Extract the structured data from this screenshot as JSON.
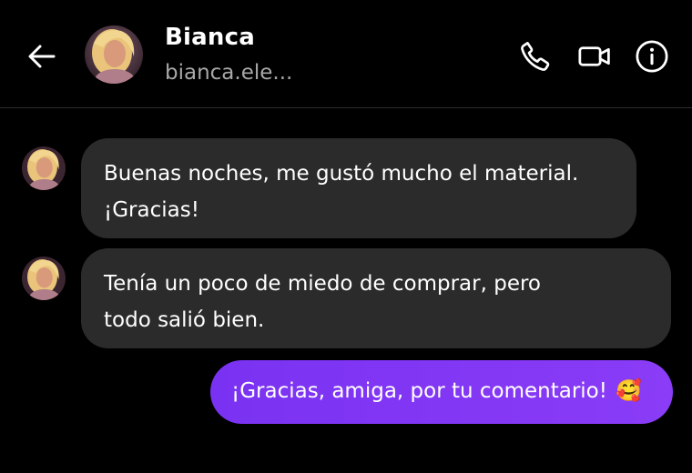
{
  "header": {
    "contact_name": "Bianca",
    "contact_handle": "bianca.ele..."
  },
  "icons": {
    "back": "back-arrow-icon",
    "call": "phone-icon",
    "video": "video-camera-icon",
    "info": "info-icon"
  },
  "colors": {
    "background": "#000000",
    "incoming_bubble": "#2b2b2b",
    "outgoing_bubble": "#7a32f2",
    "secondary_text": "#a8a8a8",
    "divider": "#2e2e2e"
  },
  "messages": [
    {
      "direction": "incoming",
      "text": "Buenas noches, me gustó mucho el material.\n¡Gracias!"
    },
    {
      "direction": "incoming",
      "text": "Tenía un poco de miedo de comprar, pero\ntodo salió bien."
    },
    {
      "direction": "outgoing",
      "text": "¡Gracias, amiga, por tu comentario!",
      "emoji": "🥰"
    }
  ]
}
